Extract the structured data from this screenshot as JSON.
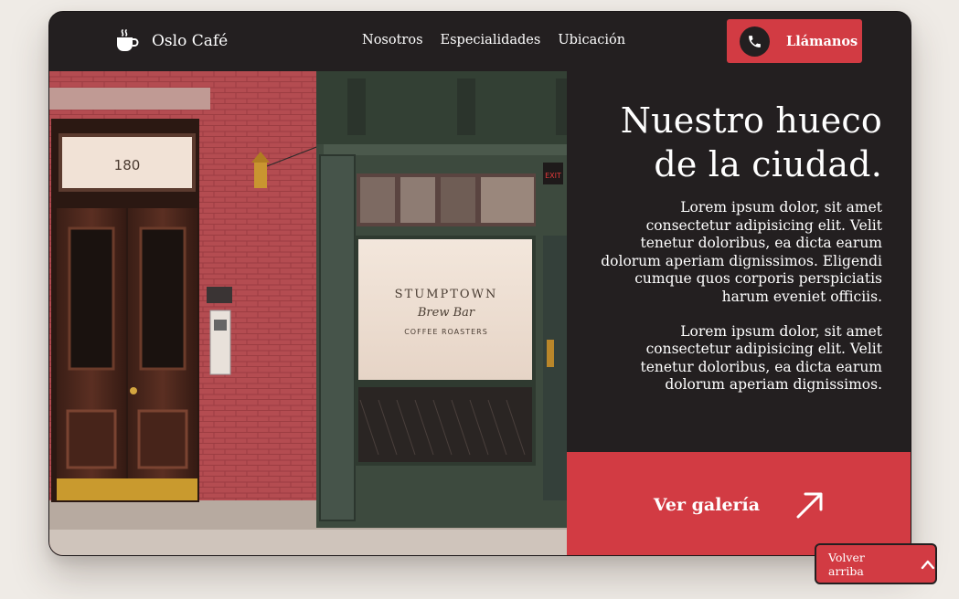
{
  "brand": {
    "name": "Oslo Café",
    "icon": "coffee-cup-icon"
  },
  "nav": {
    "links": [
      {
        "label": "Nosotros"
      },
      {
        "label": "Especialidades"
      },
      {
        "label": "Ubicación"
      }
    ],
    "call_button": {
      "label": "Llámanos",
      "icon": "phone-icon"
    }
  },
  "hero": {
    "image": {
      "door_number": "180",
      "shop_sign_line1": "STUMPTOWN",
      "shop_sign_line2": "Brew Bar",
      "shop_sign_line3": "COFFEE ROASTERS",
      "exit_sign": "EXIT"
    },
    "headline_line1": "Nuestro hueco",
    "headline_line2": "de la ciudad.",
    "paragraphs": [
      "Lorem ipsum dolor, sit amet consectetur adipisicing elit. Velit tenetur doloribus, ea dicta earum dolorum aperiam dignissimos. Eligendi cumque quos corporis perspiciatis harum eveniet officiis.",
      "Lorem ipsum dolor, sit amet consectetur adipisicing elit. Velit tenetur doloribus, ea dicta earum dolorum aperiam dignissimos."
    ]
  },
  "gallery_cta": {
    "label": "Ver galería",
    "icon": "arrow-up-right-icon"
  },
  "back_to_top": {
    "label": "Volver arriba",
    "icon": "chevron-up-icon"
  },
  "colors": {
    "background": "#efebe6",
    "card": "#231f20",
    "accent": "#d23b43",
    "text": "#ffffff",
    "brick": "#b24a4f",
    "storefront_green": "#3e4a3f"
  }
}
